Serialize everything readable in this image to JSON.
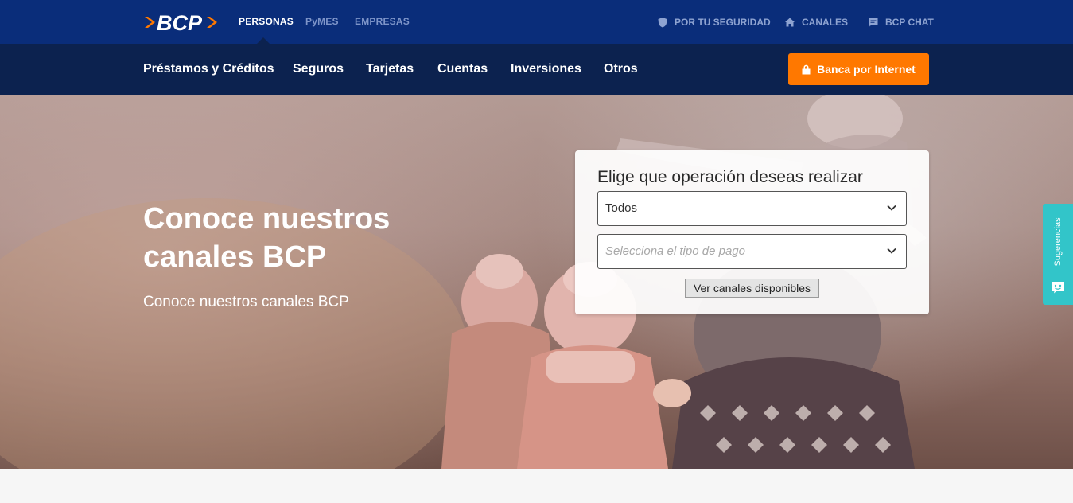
{
  "colors": {
    "topbar": "#0a2d7a",
    "mainnav": "#0c224f",
    "accent_orange": "#ff7800",
    "sugerencias_teal": "#32c5c9"
  },
  "header": {
    "logo": {
      "text": "BCP",
      "icon": "bcp-logo"
    },
    "segments": [
      {
        "label": "PERSONAS",
        "active": true
      },
      {
        "label": "PyMES",
        "active": false
      },
      {
        "label": "EMPRESAS",
        "active": false
      }
    ],
    "utilities": [
      {
        "label": "POR TU SEGURIDAD",
        "icon": "shield-icon"
      },
      {
        "label": "CANALES",
        "icon": "home-icon"
      },
      {
        "label": "BCP CHAT",
        "icon": "chat-icon"
      }
    ]
  },
  "nav": {
    "items": [
      {
        "label": "Préstamos y Créditos"
      },
      {
        "label": "Seguros"
      },
      {
        "label": "Tarjetas"
      },
      {
        "label": "Cuentas"
      },
      {
        "label": "Inversiones"
      },
      {
        "label": "Otros"
      }
    ],
    "cta": {
      "label": "Banca por Internet",
      "icon": "lock-icon"
    }
  },
  "hero": {
    "title": "Conoce nuestros canales BCP",
    "subtitle": "Conoce nuestros canales BCP"
  },
  "finder": {
    "title": "Elige que operación deseas realizar",
    "operation_select": {
      "value": "Todos"
    },
    "payment_select": {
      "placeholder": "Selecciona el tipo de pago"
    },
    "submit_label": "Ver canales disponibles"
  },
  "side_tab": {
    "label": "Sugerencias",
    "icon": "smile-icon"
  }
}
